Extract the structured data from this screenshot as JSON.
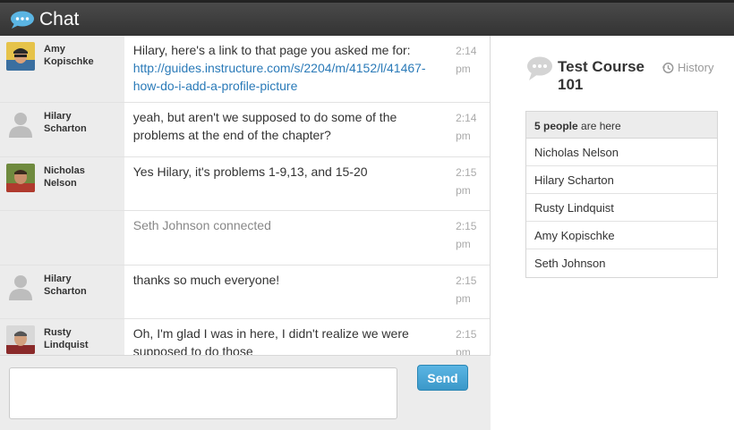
{
  "app": {
    "title": "Chat"
  },
  "messages": [
    {
      "first": "Amy",
      "last": "Kopischke",
      "text": "Hilary, here's a link to that page you asked me for:",
      "link": "http://guides.instructure.com/s/2204/m/4152/l/41467-how-do-i-add-a-profile-picture",
      "time_h": "2:14",
      "time_ampm": "pm",
      "avatar": "photo"
    },
    {
      "first": "Hilary",
      "last": "Scharton",
      "text": "yeah, but aren't we supposed to do some of the problems at the end of the chapter?",
      "time_h": "2:14",
      "time_ampm": "pm",
      "avatar": "default"
    },
    {
      "first": "Nicholas",
      "last": "Nelson",
      "text": "Yes Hilary, it's problems 1-9,13, and 15-20",
      "time_h": "2:15",
      "time_ampm": "pm",
      "avatar": "photo"
    },
    {
      "system": true,
      "text": "Seth Johnson connected",
      "time_h": "2:15",
      "time_ampm": "pm"
    },
    {
      "first": "Hilary",
      "last": "Scharton",
      "text": "thanks so much everyone!",
      "time_h": "2:15",
      "time_ampm": "pm",
      "avatar": "default"
    },
    {
      "first": "Rusty",
      "last": "Lindquist",
      "text": "Oh, I'm glad I was in here, I didn't realize we were supposed to do those",
      "time_h": "2:15",
      "time_ampm": "pm",
      "avatar": "photo"
    }
  ],
  "composer": {
    "placeholder": "",
    "send_label": "Send"
  },
  "course": {
    "title": "Test Course 101",
    "history_label": "History"
  },
  "people": {
    "count_label": "5 people",
    "suffix_label": "are here",
    "list": [
      "Nicholas Nelson",
      "Hilary Scharton",
      "Rusty Lindquist",
      "Amy Kopischke",
      "Seth Johnson"
    ]
  },
  "colors": {
    "accent": "#3b98c9",
    "link": "#2a7ab8",
    "topbar": "#3a3a3a"
  }
}
